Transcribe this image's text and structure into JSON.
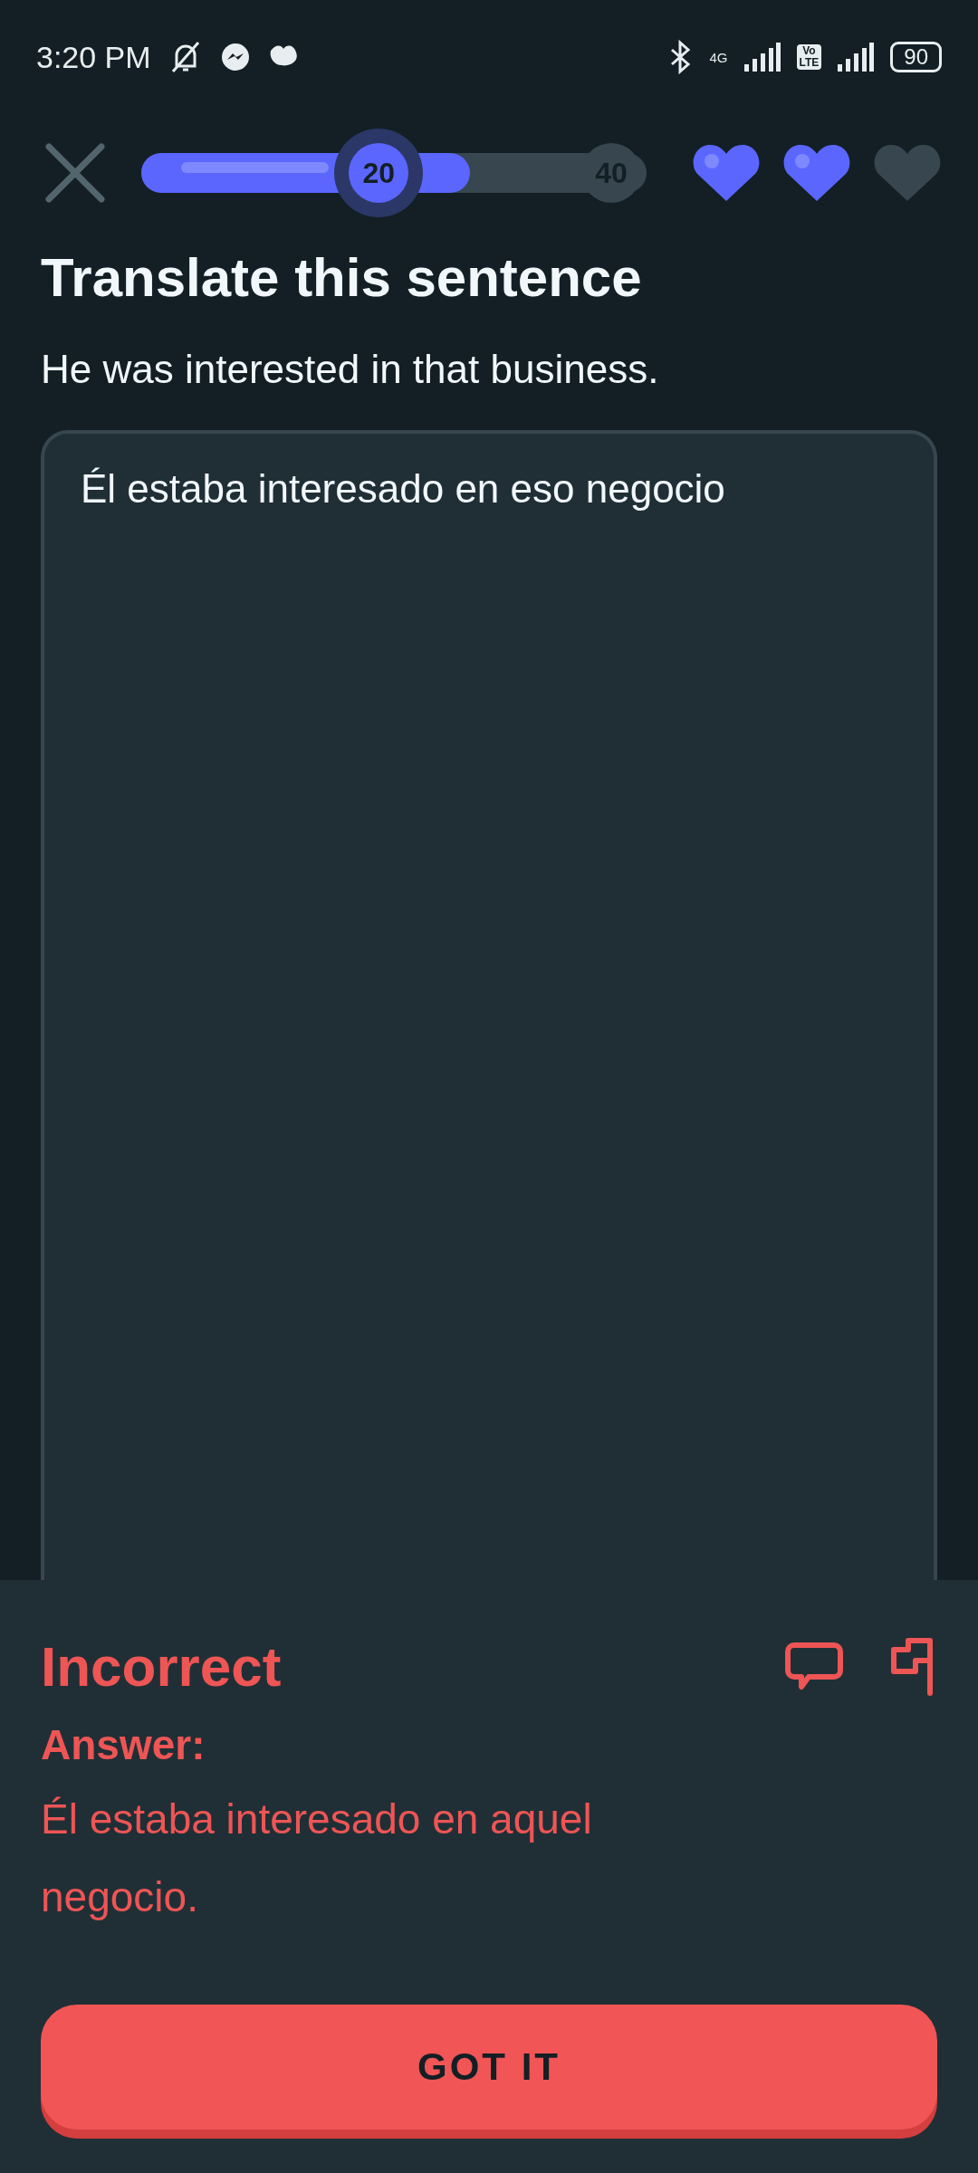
{
  "status_bar": {
    "time": "3:20 PM",
    "network": "4G",
    "volte": [
      "Vo",
      "LTE"
    ],
    "battery": "90"
  },
  "top_bar": {
    "progress": {
      "milestones": [
        {
          "label": "20",
          "reached": true
        },
        {
          "label": "40",
          "reached": false
        }
      ]
    },
    "hearts": [
      {
        "filled": true
      },
      {
        "filled": true
      },
      {
        "filled": false
      }
    ]
  },
  "title": "Translate this sentence",
  "prompt": "He was interested in that business.",
  "answer_field": {
    "value": "Él estaba interesado en eso negocio"
  },
  "feedback": {
    "result": "Incorrect",
    "answer_label": "Answer:",
    "answer": "Él estaba interesado en aquel negocio.",
    "button": "GOT IT"
  }
}
